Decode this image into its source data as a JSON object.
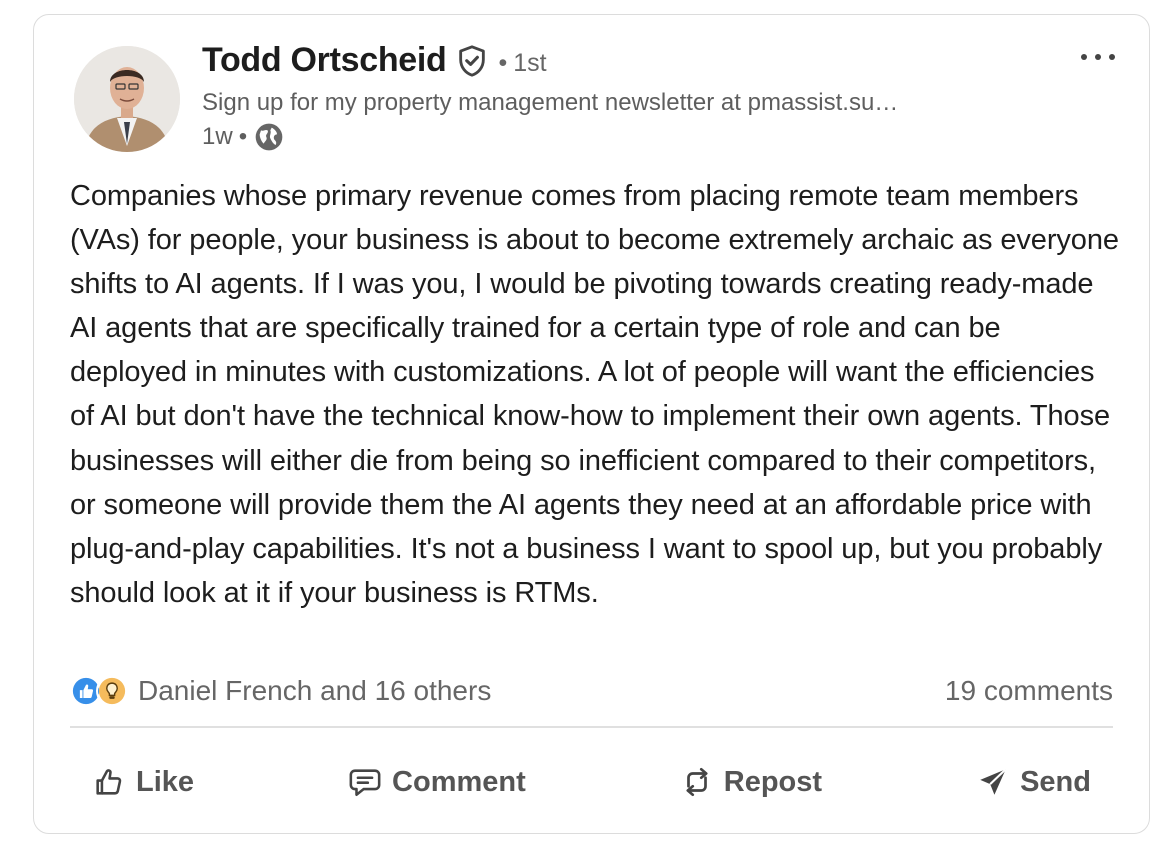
{
  "post": {
    "author": {
      "name": "Todd Ortscheid",
      "degree": "1st",
      "headline": "Sign up for my property management newsletter at pmassist.su…",
      "time": "1w"
    },
    "body": "Companies whose primary revenue comes from placing remote team members (VAs) for people, your business is about to become extremely archaic as everyone shifts to AI agents. If I was you, I would be pivoting towards creating ready-made AI agents that are specifically trained for a certain type of role and can be deployed in minutes with customizations. A lot of people will want the efficiencies of AI but don't have the technical know-how to implement their own agents. Those businesses will either die from being so inefficient compared to their competitors, or someone will provide them the AI agents they need at an affordable price with plug-and-play capabilities. It's not a business I want to spool up, but you probably should look at it if your business is RTMs."
  },
  "social": {
    "reactions_text": "Daniel French and 16 others",
    "reaction_icons": [
      "like-icon",
      "insightful-icon"
    ],
    "comments_text": "19 comments"
  },
  "actions": {
    "like": "Like",
    "comment": "Comment",
    "repost": "Repost",
    "send": "Send"
  },
  "colors": {
    "like_blue": "#378fe9",
    "insightful_yellow": "#f5bb5c",
    "text_primary": "#1d1d1d",
    "text_secondary": "#666666"
  }
}
